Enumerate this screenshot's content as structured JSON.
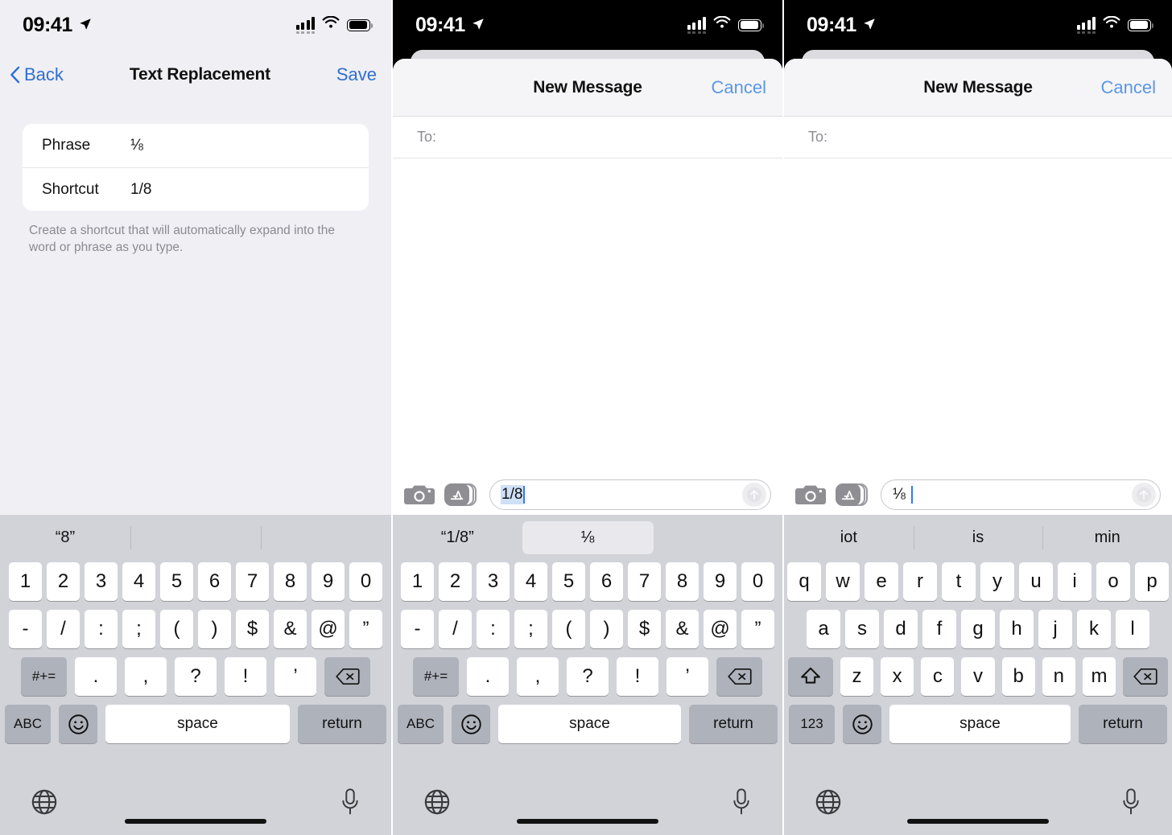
{
  "statusbar": {
    "time": "09:41",
    "location_icon": "location-arrow-icon",
    "signal_icon": "cellular-signal-icon",
    "wifi_icon": "wifi-icon",
    "battery_icon": "battery-full-icon"
  },
  "panel1": {
    "nav": {
      "back_label": "Back",
      "title": "Text Replacement",
      "save_label": "Save"
    },
    "rows": [
      {
        "label": "Phrase",
        "value": "⅛"
      },
      {
        "label": "Shortcut",
        "value": "1/8"
      }
    ],
    "footnote": "Create a shortcut that will automatically expand into the word or phrase as you type.",
    "keyboard": {
      "type": "numeric",
      "suggestions": [
        "“8”",
        "",
        ""
      ],
      "highlighted_suggestion_index": -1,
      "row1": [
        "1",
        "2",
        "3",
        "4",
        "5",
        "6",
        "7",
        "8",
        "9",
        "0"
      ],
      "row2": [
        "-",
        "/",
        ":",
        ";",
        "(",
        ")",
        "$",
        "&",
        "@",
        "”"
      ],
      "row3_mod": "#+=",
      "row3": [
        ".",
        ",",
        "?",
        "!",
        "’"
      ],
      "row3_backspace": "backspace-icon",
      "row4_mode": "ABC",
      "row4_emoji": "emoji-icon",
      "row4_space": "space",
      "row4_return": "return",
      "globe_icon": "globe-icon",
      "mic_icon": "microphone-icon"
    }
  },
  "panel2": {
    "sheet": {
      "title": "New Message",
      "cancel_label": "Cancel",
      "to_label": "To:"
    },
    "compose": {
      "camera_icon": "camera-icon",
      "appstore_icon": "app-store-icon",
      "input_value": "1/8",
      "input_marked": true,
      "send_icon": "send-arrow-up-icon"
    },
    "keyboard": {
      "type": "numeric",
      "suggestions": [
        "“1/8”",
        "⅛",
        ""
      ],
      "highlighted_suggestion_index": 1,
      "row1": [
        "1",
        "2",
        "3",
        "4",
        "5",
        "6",
        "7",
        "8",
        "9",
        "0"
      ],
      "row2": [
        "-",
        "/",
        ":",
        ";",
        "(",
        ")",
        "$",
        "&",
        "@",
        "”"
      ],
      "row3_mod": "#+=",
      "row3": [
        ".",
        ",",
        "?",
        "!",
        "’"
      ],
      "row3_backspace": "backspace-icon",
      "row4_mode": "ABC",
      "row4_emoji": "emoji-icon",
      "row4_space": "space",
      "row4_return": "return",
      "globe_icon": "globe-icon",
      "mic_icon": "microphone-icon"
    }
  },
  "panel3": {
    "sheet": {
      "title": "New Message",
      "cancel_label": "Cancel",
      "to_label": "To:"
    },
    "compose": {
      "camera_icon": "camera-icon",
      "appstore_icon": "app-store-icon",
      "input_value": "⅛",
      "input_marked": false,
      "send_icon": "send-arrow-up-icon"
    },
    "keyboard": {
      "type": "qwerty",
      "suggestions": [
        "iot",
        "is",
        "min"
      ],
      "highlighted_suggestion_index": -1,
      "row1": [
        "q",
        "w",
        "e",
        "r",
        "t",
        "y",
        "u",
        "i",
        "o",
        "p"
      ],
      "row2": [
        "a",
        "s",
        "d",
        "f",
        "g",
        "h",
        "j",
        "k",
        "l"
      ],
      "row3_shift": "shift-icon",
      "row3": [
        "z",
        "x",
        "c",
        "v",
        "b",
        "n",
        "m"
      ],
      "row3_backspace": "backspace-icon",
      "row4_mode": "123",
      "row4_emoji": "emoji-icon",
      "row4_space": "space",
      "row4_return": "return",
      "globe_icon": "globe-icon",
      "mic_icon": "microphone-icon"
    }
  },
  "colors": {
    "accent_blue": "#2f6fd0",
    "sheet_blue": "#5b96e8",
    "keyboard_bg": "#d1d3d9",
    "settings_bg": "#f0eff4",
    "marked_text": "#cfe0f7"
  }
}
